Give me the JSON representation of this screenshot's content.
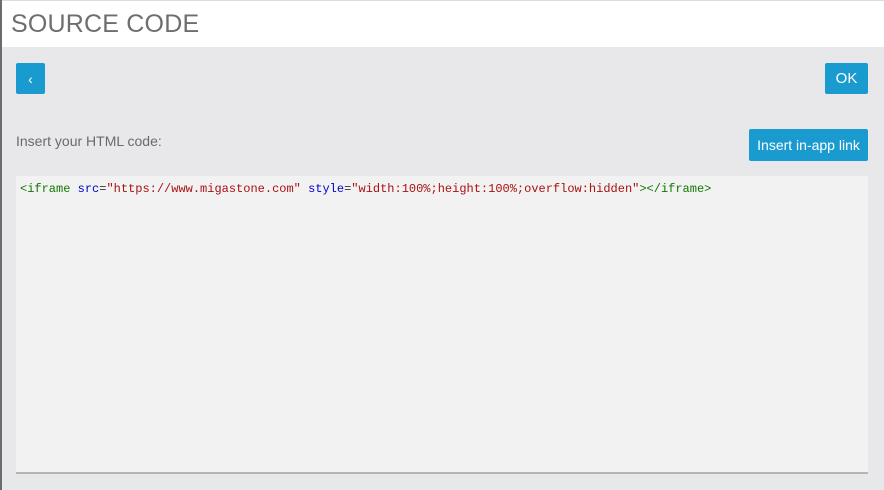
{
  "header": {
    "title": "SOURCE CODE"
  },
  "toolbar": {
    "back_label": "‹",
    "ok_label": "OK"
  },
  "editor": {
    "label": "Insert your HTML code:",
    "insert_link_label": "Insert in-app link",
    "code": {
      "open_tag": "<iframe",
      "attr_src": "src",
      "eq1": "=",
      "src_value": "\"https://www.migastone.com\"",
      "attr_style": "style",
      "eq2": "=",
      "style_value": "\"width:100%;height:100%;overflow:hidden\"",
      "close_open_tag": "></iframe>"
    }
  },
  "colors": {
    "accent": "#1a9bd0",
    "code_tag": "#117700",
    "code_attr": "#0000cc",
    "code_string": "#aa1111"
  }
}
